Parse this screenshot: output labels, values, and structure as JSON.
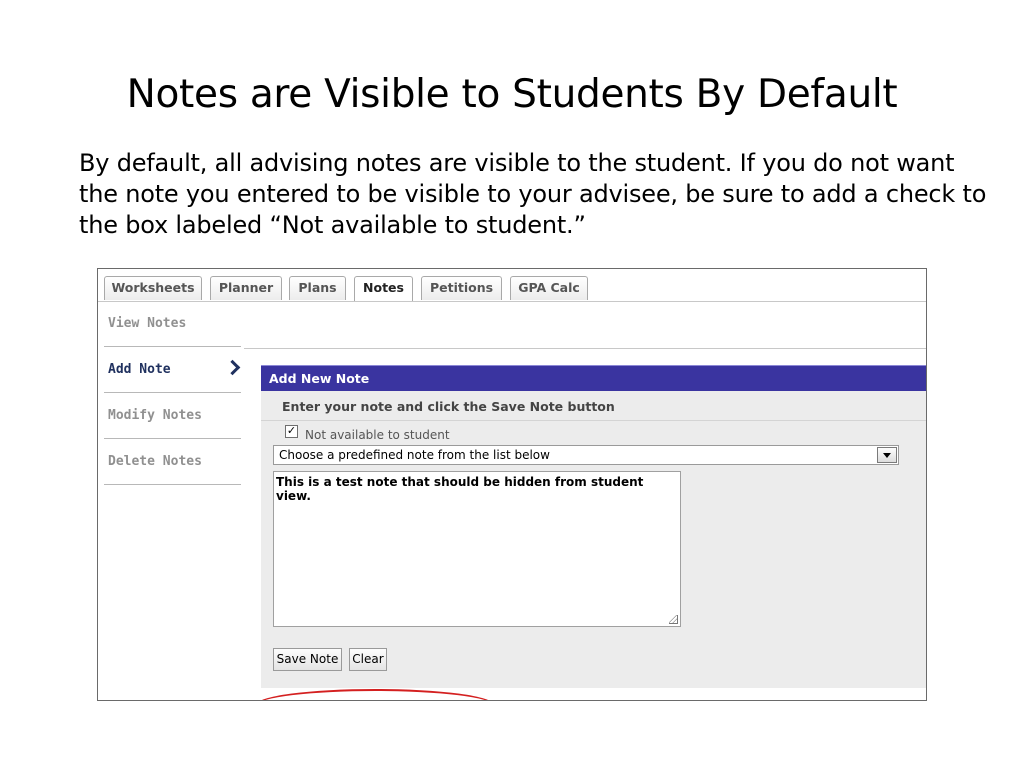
{
  "slide": {
    "title": "Notes are Visible to Students By Default",
    "body": "By default, all advising notes are visible to the student.  If you do not want the note you entered to be visible to your advisee, be sure to add a check to the box labeled “Not available to student.”"
  },
  "tabs": [
    "Worksheets",
    "Planner",
    "Plans",
    "Notes",
    "Petitions",
    "GPA Calc"
  ],
  "active_tab": "Notes",
  "sidebar": {
    "items": [
      {
        "label": "View Notes"
      },
      {
        "label": "Add Note"
      },
      {
        "label": "Modify Notes"
      },
      {
        "label": "Delete Notes"
      }
    ],
    "active": "Add Note"
  },
  "panel": {
    "header": "Add New Note",
    "instructions": "Enter your note and click the Save Note button",
    "checkbox_label": "Not available to student",
    "checkbox_checked": true,
    "check_mark": "✓",
    "select_value": "Choose a predefined note from the list below",
    "textarea_value": "This is a test note that should be hidden from student view.",
    "save_label": "Save Note",
    "clear_label": "Clear"
  },
  "colors": {
    "header_bg": "#3a34a0",
    "highlight_ellipse": "#d42020",
    "active_nav": "#20315f"
  }
}
